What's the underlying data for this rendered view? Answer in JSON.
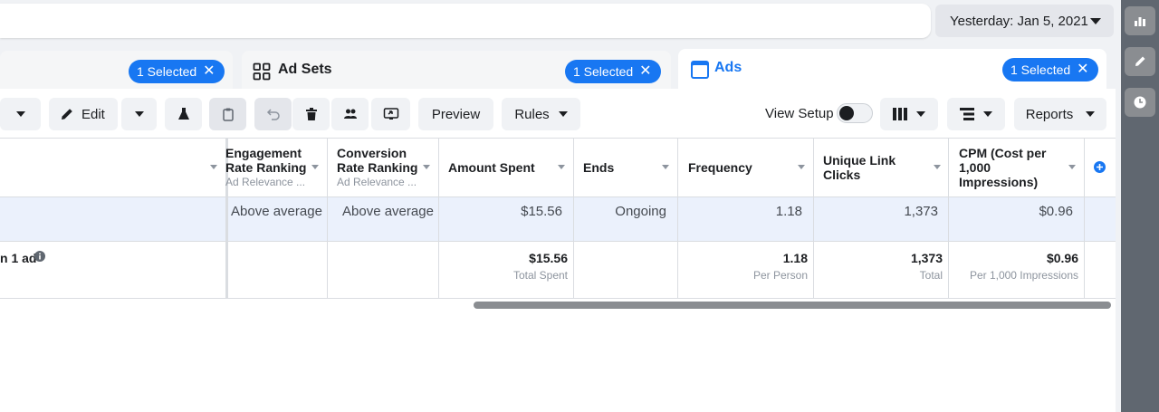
{
  "date_range": {
    "label": "Yesterday: Jan 5, 2021"
  },
  "tabs": {
    "campaigns": {
      "selected_label": "1 Selected"
    },
    "ad_sets": {
      "title": "Ad Sets",
      "selected_label": "1 Selected"
    },
    "ads": {
      "title": "Ads",
      "selected_label": "1 Selected"
    }
  },
  "toolbar": {
    "edit_label": "Edit",
    "preview_label": "Preview",
    "rules_label": "Rules",
    "view_setup_label": "View Setup",
    "reports_label": "Reports"
  },
  "table": {
    "columns": [
      {
        "title": "Engagement Rate Ranking",
        "sub": "Ad Relevance ..."
      },
      {
        "title": "Conversion Rate Ranking",
        "sub": "Ad Relevance ..."
      },
      {
        "title": "Amount Spent",
        "sub": ""
      },
      {
        "title": "Ends",
        "sub": ""
      },
      {
        "title": "Frequency",
        "sub": ""
      },
      {
        "title": "Unique Link Clicks",
        "sub": ""
      },
      {
        "title": "CPM (Cost per 1,000 Impressions)",
        "sub": ""
      }
    ],
    "row": [
      "Above average",
      "Above average",
      "$15.56",
      "Ongoing",
      "1.18",
      "1,373",
      "$0.96"
    ],
    "totals": {
      "label": "n 1 ad",
      "values": [
        "$15.56",
        "1.18",
        "1,373",
        "$0.96"
      ],
      "captions": [
        "Total Spent",
        "Per Person",
        "Total",
        "Per 1,000 Impressions"
      ]
    }
  },
  "colors": {
    "accent": "#1877f2",
    "row_highlight": "#ebf1fc",
    "rail": "#606770"
  },
  "icons": [
    "caret-down-icon",
    "close-icon",
    "ad-sets-grid-icon",
    "ads-window-icon",
    "pencil-icon",
    "flask-icon",
    "clipboard-icon",
    "undo-icon",
    "trash-icon",
    "people-icon",
    "export-icon",
    "columns-icon",
    "breakdown-icon",
    "add-column-icon",
    "info-icon",
    "chart-icon",
    "edit-icon",
    "clock-icon"
  ]
}
